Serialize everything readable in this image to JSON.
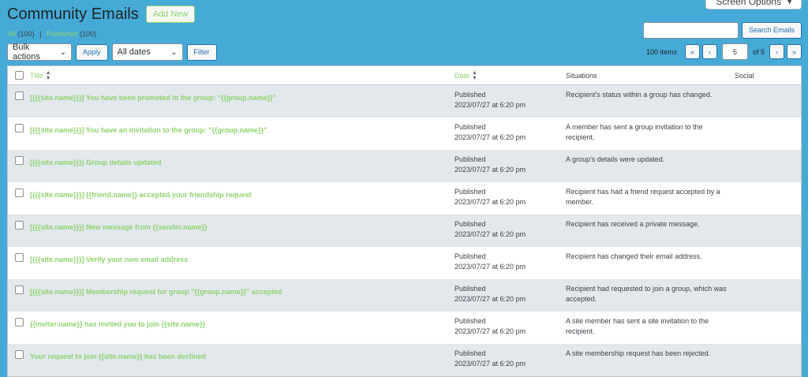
{
  "header": {
    "title": "Community Emails",
    "add_new_label": "Add New",
    "screen_options_label": "Screen Options"
  },
  "views": {
    "all_label": "All",
    "all_count": "(100)",
    "separator": "|",
    "published_label": "Published",
    "published_count": "(100)"
  },
  "search": {
    "value": "",
    "button_label": "Search Emails"
  },
  "tablenav": {
    "bulk_actions_label": "Bulk actions",
    "apply_label": "Apply",
    "dates_label": "All dates",
    "filter_label": "Filter"
  },
  "pagination": {
    "items_label": "100 items",
    "first": "«",
    "prev": "‹",
    "current_page": "5",
    "of_pages": "of 5",
    "next": "›",
    "last": "»"
  },
  "table": {
    "columns": {
      "title": "Title",
      "date": "Date",
      "situations": "Situations",
      "social": "Social"
    },
    "rows": [
      {
        "title": "[{{{site.name}}}] You have been promoted in the group: \"{{group.name}}\"",
        "status": "Published",
        "date": "2023/07/27 at 6:20 pm",
        "situation": "Recipient's status within a group has changed."
      },
      {
        "title": "[{{{site.name}}}] You have an invitation to the group: \"{{group.name}}\"",
        "status": "Published",
        "date": "2023/07/27 at 6:20 pm",
        "situation": "A member has sent a group invitation to the recipient."
      },
      {
        "title": "[{{{site.name}}}] Group details updated",
        "status": "Published",
        "date": "2023/07/27 at 6:20 pm",
        "situation": "A group's details were updated."
      },
      {
        "title": "[{{{site.name}}}] {{friend.name}} accepted your friendship request",
        "status": "Published",
        "date": "2023/07/27 at 6:20 pm",
        "situation": "Recipient has had a friend request accepted by a member."
      },
      {
        "title": "[{{{site.name}}}] New message from {{sender.name}}",
        "status": "Published",
        "date": "2023/07/27 at 6:20 pm",
        "situation": "Recipient has received a private message."
      },
      {
        "title": "[{{{site.name}}}] Verify your new email address",
        "status": "Published",
        "date": "2023/07/27 at 6:20 pm",
        "situation": "Recipient has changed their email address."
      },
      {
        "title": "[{{{site.name}}}] Membership request for group \"{{group.name}}\" accepted",
        "status": "Published",
        "date": "2023/07/27 at 6:20 pm",
        "situation": "Recipient had requested to join a group, which was accepted."
      },
      {
        "title": "{{inviter.name}} has invited you to join {{site.name}}",
        "status": "Published",
        "date": "2023/07/27 at 6:20 pm",
        "situation": "A site member has sent a site invitation to the recipient."
      },
      {
        "title": "Your request to join {{site.name}} has been declined",
        "status": "Published",
        "date": "2023/07/27 at 6:20 pm",
        "situation": "A site membership request has been rejected."
      }
    ]
  },
  "icons": {
    "sort": "sort-arrows-icon",
    "dropdown": "chevron-down-icon"
  },
  "colors": {
    "background": "#45aad6",
    "accent_link": "#8fd36e",
    "primary": "#2271b1"
  }
}
